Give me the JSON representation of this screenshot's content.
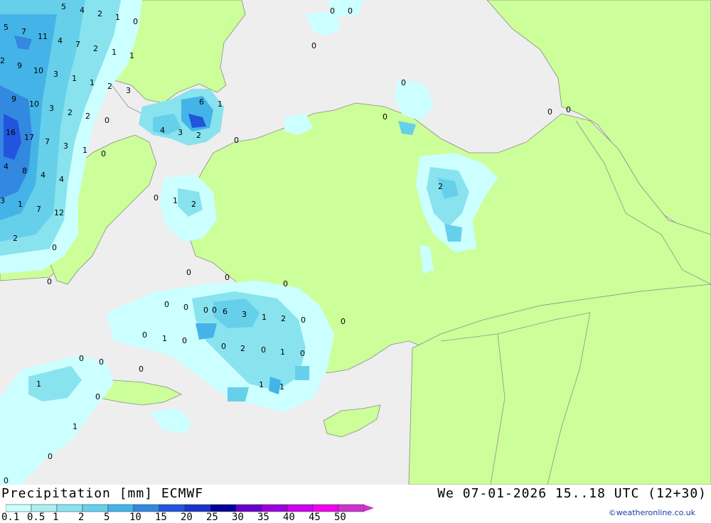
{
  "title": "Precipitation [mm] ECMWF",
  "datetime": "We 07-01-2026 15..18 UTC (12+30)",
  "credit": "©weatheronline.co.uk",
  "colors": {
    "sea": "#eeeeee",
    "land": "#ccff99",
    "border": "#909090"
  },
  "legend": {
    "labels": [
      "0.1",
      "0.5",
      "1",
      "2",
      "5",
      "10",
      "15",
      "20",
      "25",
      "30",
      "35",
      "40",
      "45",
      "50"
    ],
    "colors": [
      "#ccffff",
      "#aaf0f0",
      "#88e3ee",
      "#66d0ea",
      "#44b4e8",
      "#3388e0",
      "#2255dd",
      "#1a33cc",
      "#000099",
      "#6600cc",
      "#9900dd",
      "#cc00ee",
      "#ee00ee",
      "#cc33cc"
    ]
  },
  "values": [
    "0",
    "0",
    "5",
    "4",
    "2",
    "1",
    "0",
    "5",
    "7",
    "11",
    "4",
    "7",
    "2",
    "1",
    "1",
    "0",
    "2",
    "9",
    "10",
    "3",
    "1",
    "1",
    "2",
    "3",
    "9",
    "10",
    "3",
    "2",
    "2",
    "0",
    "6",
    "1",
    "16",
    "17",
    "7",
    "3",
    "1",
    "0",
    "4",
    "3",
    "2",
    "0",
    "4",
    "8",
    "4",
    "4",
    "0",
    "1",
    "2",
    "3",
    "1",
    "7",
    "12",
    "2",
    "0",
    "0",
    "0",
    "0",
    "0",
    "0",
    "0",
    "0",
    "2",
    "0",
    "0",
    "0",
    "0",
    "0",
    "6",
    "3",
    "1",
    "2",
    "0",
    "0",
    "0",
    "1",
    "0",
    "2",
    "0",
    "1",
    "0",
    "0",
    "0",
    "0",
    "1",
    "1",
    "1",
    "0",
    "0",
    "1",
    "0",
    "0"
  ]
}
